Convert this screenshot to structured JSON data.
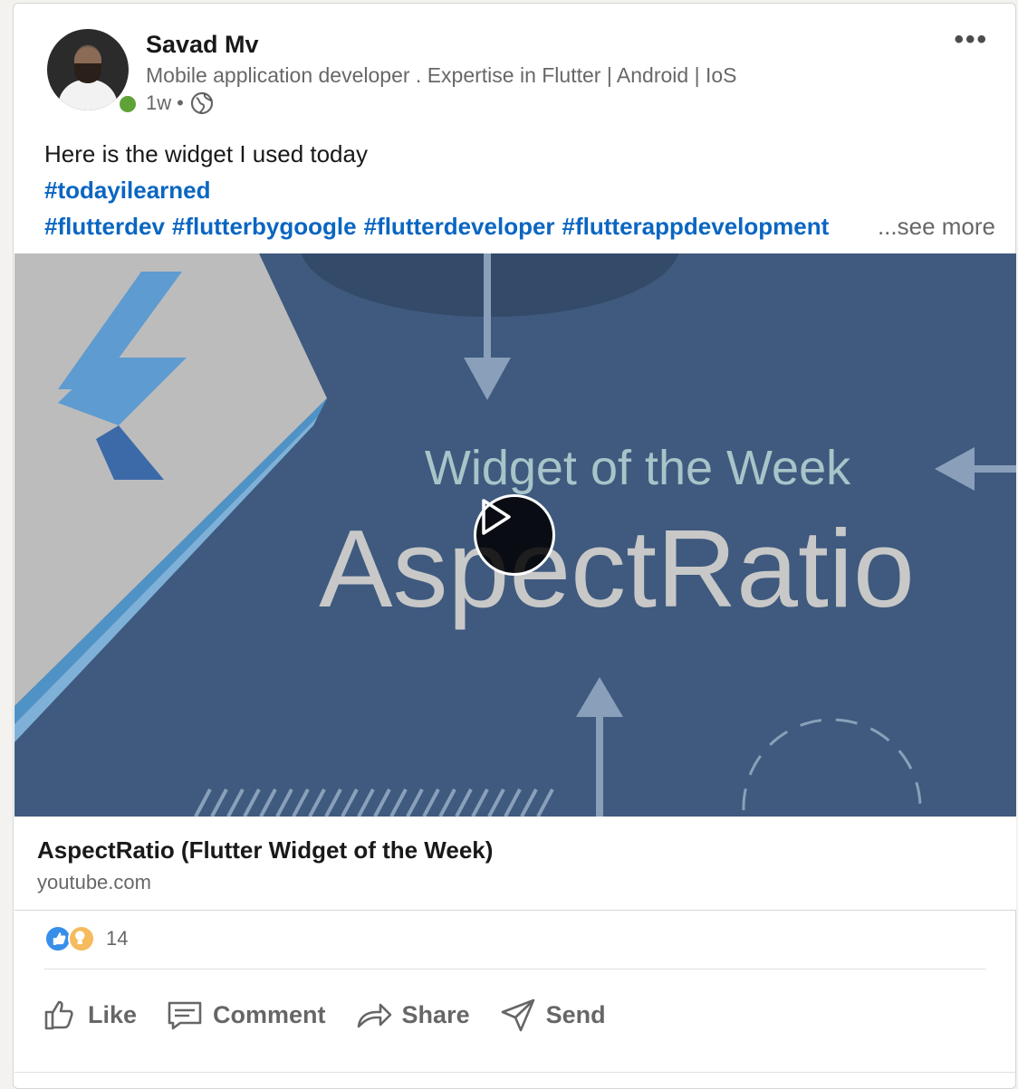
{
  "author": {
    "name": "Savad Mv",
    "headline": "Mobile application developer . Expertise in Flutter | Android | IoS",
    "time": "1w",
    "separator": "•",
    "visibility_icon": "globe-icon",
    "online_status": "online",
    "presence_color": "#5fa237"
  },
  "menu": {
    "overflow_label": "•••"
  },
  "commentary": {
    "text": "Here is the widget I used today",
    "hashtag_line1": "#todayilearned",
    "hashtags": [
      "#flutterdev",
      "#flutterbygoogle",
      "#flutterdeveloper",
      "#flutterappdevelopment"
    ],
    "see_more": "...see more"
  },
  "video": {
    "overline": "Widget of the Week",
    "headline": "AspectRatio",
    "play_icon": "play-icon"
  },
  "link_preview": {
    "title": "AspectRatio (Flutter Widget of the Week)",
    "domain": "youtube.com"
  },
  "social": {
    "reaction_icons": [
      "like-reaction-icon",
      "insightful-reaction-icon"
    ],
    "reaction_count": "14"
  },
  "actions": {
    "like": "Like",
    "comment": "Comment",
    "share": "Share",
    "send": "Send"
  },
  "colors": {
    "hashtag": "#0a66c2",
    "video_background": "#3f5a7e",
    "like_reaction": "#378fe9",
    "insight_reaction": "#f5bb5c"
  }
}
